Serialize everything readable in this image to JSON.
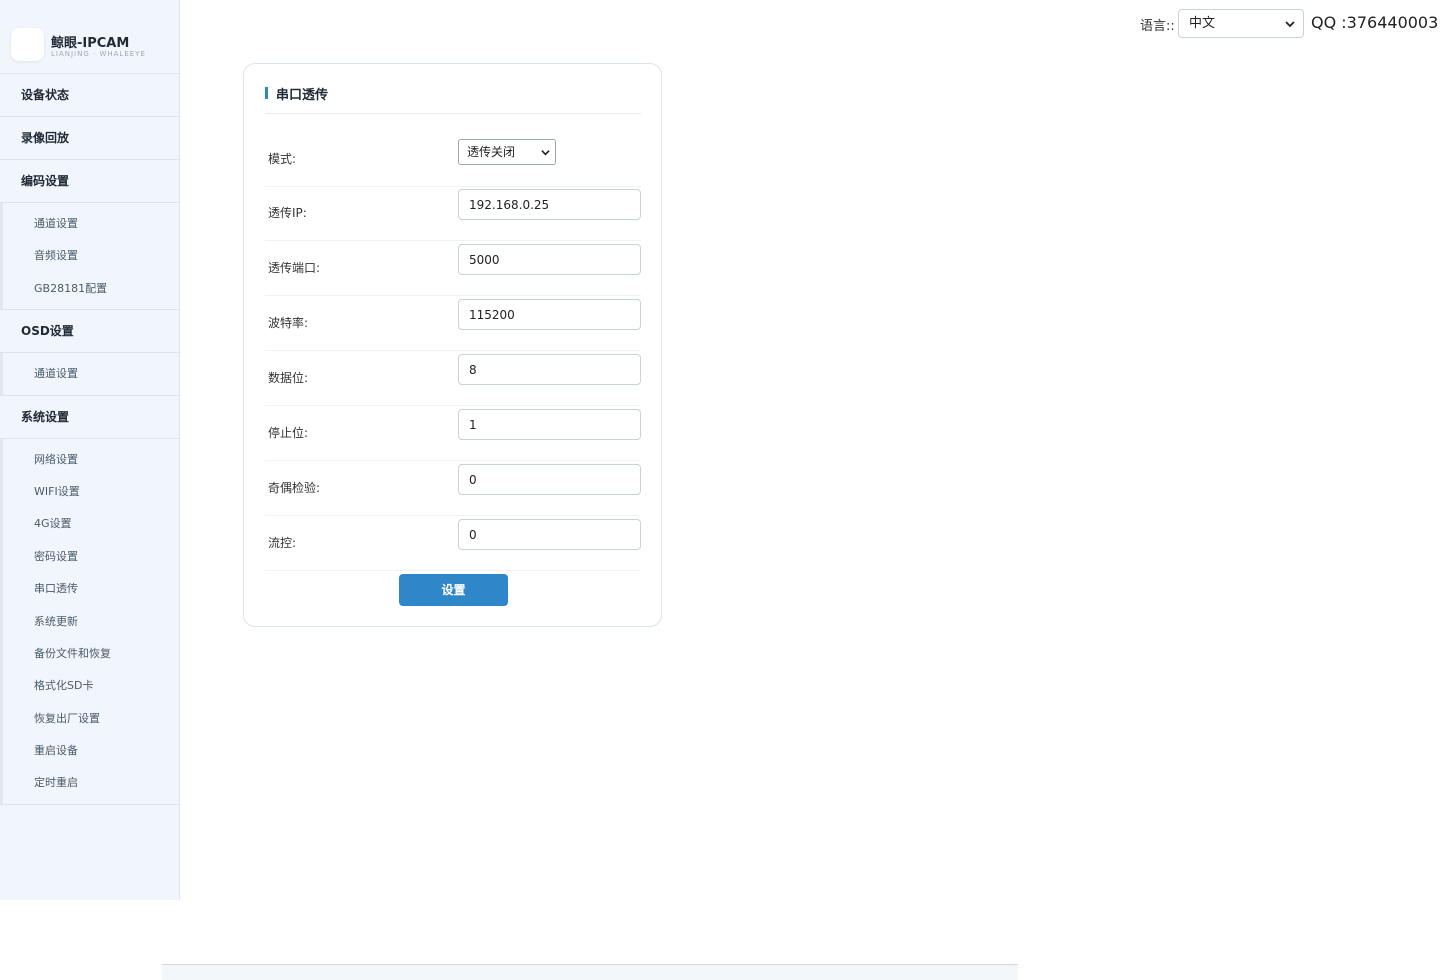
{
  "brand": {
    "title": "鲸眼-IPCAM",
    "subtitle": "LIANJING · WHALEEYE"
  },
  "sidebar": {
    "sections": [
      {
        "label": "设备状态",
        "items": []
      },
      {
        "label": "录像回放",
        "items": []
      },
      {
        "label": "编码设置",
        "items": [
          "通道设置",
          "音频设置",
          "GB28181配置"
        ]
      },
      {
        "label": "OSD设置",
        "items": [
          "通道设置"
        ]
      },
      {
        "label": "系统设置",
        "items": [
          "网络设置",
          "WIFI设置",
          "4G设置",
          "密码设置",
          "串口透传",
          "系统更新",
          "备份文件和恢复",
          "格式化SD卡",
          "恢复出厂设置",
          "重启设备",
          "定时重启"
        ]
      }
    ]
  },
  "header": {
    "lang_label": "语言::",
    "lang_value": "中文",
    "qq": "QQ :376440003"
  },
  "card": {
    "title": "串口透传",
    "mode": {
      "label": "模式:",
      "value": "透传关闭"
    },
    "fields": [
      {
        "label": "透传IP:",
        "value": "192.168.0.25"
      },
      {
        "label": "透传端口:",
        "value": "5000"
      },
      {
        "label": "波特率:",
        "value": "115200"
      },
      {
        "label": "数据位:",
        "value": "8"
      },
      {
        "label": "停止位:",
        "value": "1"
      },
      {
        "label": "奇偶检验:",
        "value": "0"
      },
      {
        "label": "流控:",
        "value": "0"
      }
    ],
    "submit_label": "设置"
  },
  "colors": {
    "accent": "#2f86c8",
    "sidebar_bg": "#f1f6fc"
  }
}
